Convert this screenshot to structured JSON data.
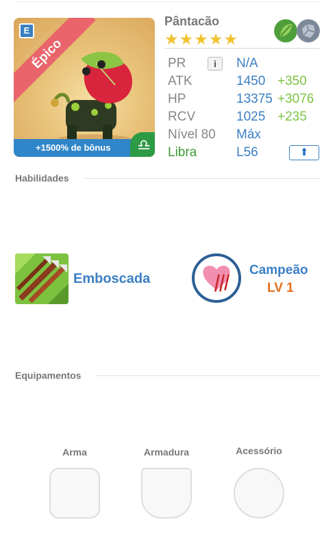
{
  "monster": {
    "name": "Pântacão",
    "rarity": "Épico",
    "stars": "★★★★★",
    "bonus_text": "+1500% de bônus",
    "zodiac_symbol": "♎",
    "card_badge": "E",
    "elements": [
      "leaf-icon",
      "stone-icon"
    ]
  },
  "stats": {
    "pr": {
      "label": "PR",
      "info": "i",
      "value": "N/A"
    },
    "atk": {
      "label": "ATK",
      "value": "1450",
      "bonus": "+350"
    },
    "hp": {
      "label": "HP",
      "value": "13375",
      "bonus": "+3076"
    },
    "rcv": {
      "label": "RCV",
      "value": "1025",
      "bonus": "+235"
    },
    "level": {
      "label": "Nível 80",
      "value": "Máx"
    },
    "sign": {
      "label": "Libra",
      "value": "L56",
      "upgrade_icon": "⬆"
    }
  },
  "skills": {
    "title": "Habilidades",
    "active": {
      "name": "Emboscada"
    },
    "leader": {
      "name": "Campeão",
      "level": "LV 1"
    }
  },
  "equipment": {
    "title": "Equipamentos",
    "slots": [
      {
        "label": "Arma"
      },
      {
        "label": "Armadura"
      },
      {
        "label": "Acessório"
      }
    ]
  },
  "colors": {
    "accent_blue": "#3b7fc4",
    "bonus_green": "#7cc244",
    "level_orange": "#e36e1b",
    "ribbon_red": "#e9646b"
  }
}
